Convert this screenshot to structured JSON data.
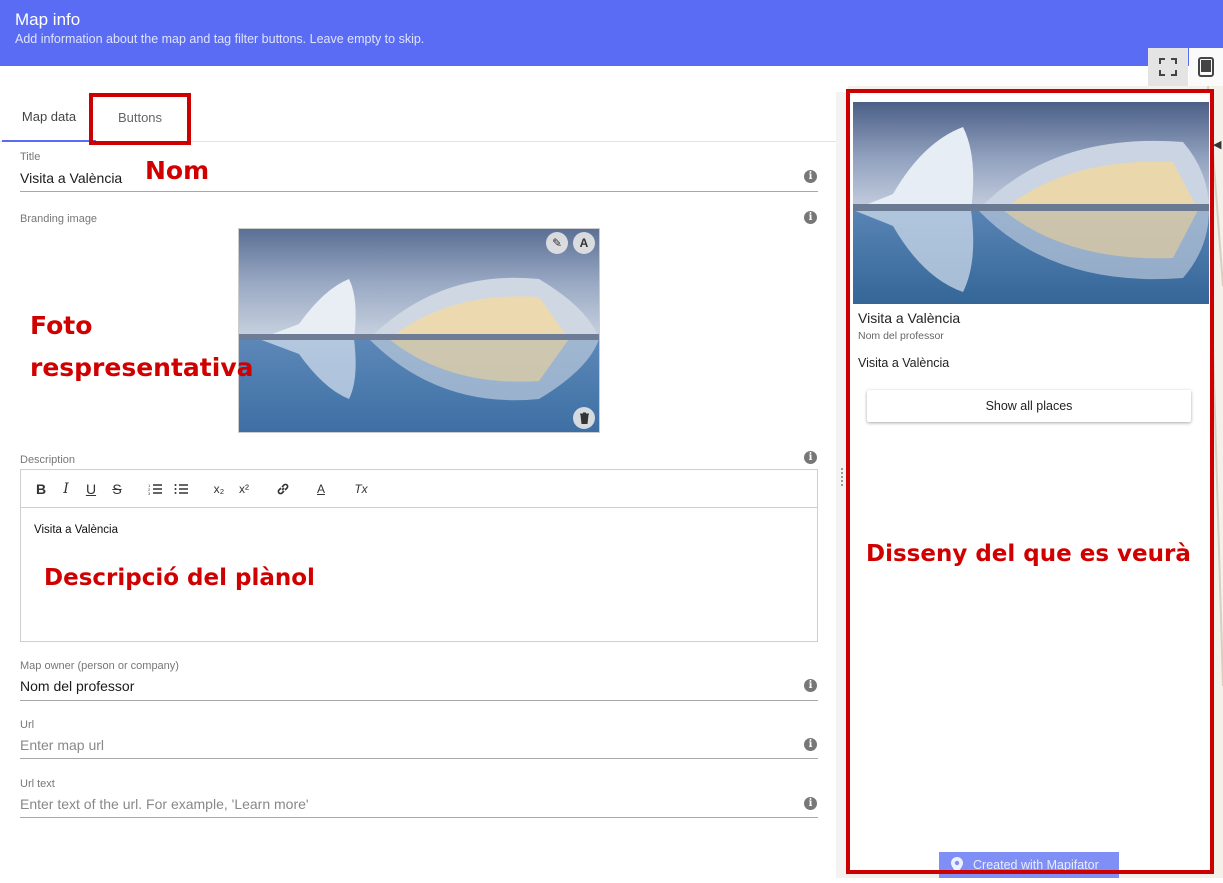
{
  "header": {
    "title": "Map info",
    "subtitle": "Add information about the map and tag filter buttons. Leave empty to skip."
  },
  "view_toggles": [
    {
      "icon": "fullscreen-icon"
    },
    {
      "icon": "tablet-icon"
    }
  ],
  "tabs": [
    {
      "label": "Map data",
      "active": true
    },
    {
      "label": "Buttons",
      "active": false
    }
  ],
  "form": {
    "title": {
      "label": "Title",
      "value": "Visita a València"
    },
    "branding": {
      "label": "Branding image"
    },
    "description": {
      "label": "Description",
      "value": "Visita a València"
    },
    "owner": {
      "label": "Map owner (person or company)",
      "value": "Nom del professor"
    },
    "url": {
      "label": "Url",
      "placeholder": "Enter map url"
    },
    "url_text": {
      "label": "Url text",
      "placeholder": "Enter text of the url. For example, 'Learn more'"
    }
  },
  "toolbar": {
    "bold": "B",
    "italic": "I",
    "underline": "U",
    "strike": "S",
    "ordered_list": "≡",
    "bullet_list": "≡",
    "subscript": "x₂",
    "superscript": "x²",
    "link": "⊘",
    "color": "A",
    "clear": "Tx"
  },
  "image_buttons": {
    "edit": "✎",
    "alt": "A",
    "delete": "🗑"
  },
  "preview": {
    "title": "Visita a València",
    "owner": "Nom del professor",
    "description": "Visita a València",
    "button": "Show all places",
    "footer": "Created with Mapifator"
  },
  "annotations": {
    "nom": "Nom",
    "foto": "Foto",
    "foto2": "respresentativa",
    "descripcio": "Descripció del plànol",
    "disseny": "Disseny del que es veurà"
  },
  "colors": {
    "accent": "#5a6cf3",
    "annotation": "#cc0000"
  }
}
